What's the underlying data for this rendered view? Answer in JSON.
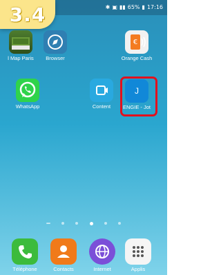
{
  "step": {
    "label": "3.4"
  },
  "statusbar": {
    "battery": "65%",
    "time": "17:16"
  },
  "apps_row1": [
    {
      "label": "l Map Paris",
      "icon": "map-icon"
    },
    {
      "label": "Browser",
      "icon": "compass-icon"
    },
    {
      "label": "Orange Cash",
      "icon": "orange-cash-icon"
    }
  ],
  "apps_row2": [
    {
      "label": "WhatsApp",
      "icon": "whatsapp-icon"
    },
    {
      "label": "Content",
      "icon": "content-icon"
    },
    {
      "label": "ENGIE - Jot",
      "icon": "engie-icon",
      "glyph": "J"
    }
  ],
  "dock": [
    {
      "label": "Téléphone",
      "icon": "phone-icon"
    },
    {
      "label": "Contacts",
      "icon": "contacts-icon"
    },
    {
      "label": "Internet",
      "icon": "internet-icon"
    },
    {
      "label": "Applis",
      "icon": "apps-grid-icon"
    }
  ],
  "colors": {
    "highlight": "#e3101d",
    "badge": "#fbe58b"
  },
  "page_indicator": {
    "count": 6,
    "active_index": 3
  }
}
